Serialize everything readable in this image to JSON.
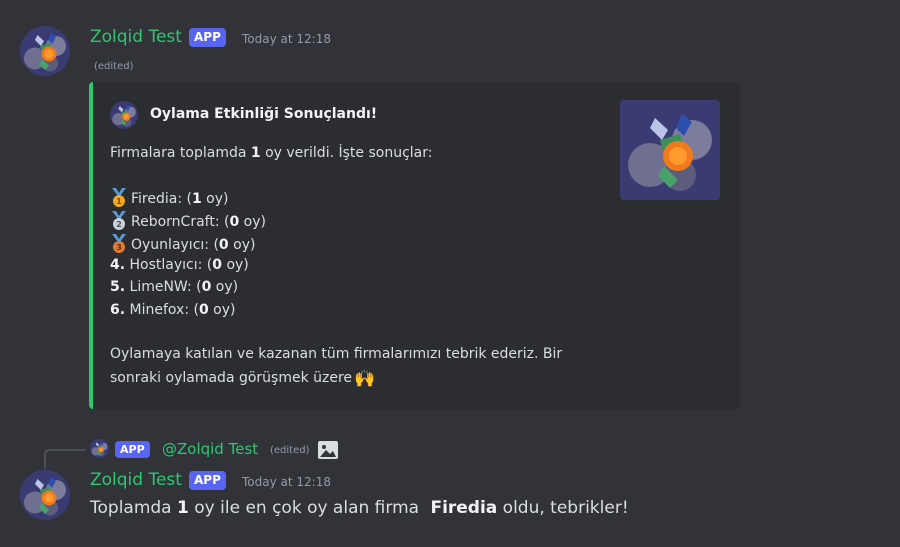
{
  "message1": {
    "username": "Zolqid Test",
    "badge": "APP",
    "timestamp": "Today at 12:18",
    "edited": "(edited)",
    "embed": {
      "accent_color": "#2dc770",
      "title": "Oylama Etkinliği Sonuçlandı!",
      "intro": {
        "before": "Firmalara toplamda ",
        "count": "1",
        "after": " oy verildi. İşte sonuçlar:"
      },
      "results": [
        {
          "rank_icon": "gold-medal-icon",
          "name": "Firedia: (",
          "votes": "1",
          "suffix": " oy)"
        },
        {
          "rank_icon": "silver-medal-icon",
          "name": "RebornCraft: (",
          "votes": "0",
          "suffix": " oy)"
        },
        {
          "rank_icon": "bronze-medal-icon",
          "name": "Oyunlayıcı: (",
          "votes": "0",
          "suffix": " oy)"
        },
        {
          "rank": "4.",
          "name": " Hostlayıcı: (",
          "votes": "0",
          "suffix": " oy)"
        },
        {
          "rank": "5.",
          "name": " LimeNW: (",
          "votes": "0",
          "suffix": " oy)"
        },
        {
          "rank": "6.",
          "name": " Minefox: (",
          "votes": "0",
          "suffix": " oy)"
        }
      ],
      "footer_line1": "Oylamaya katılan ve kazanan tüm firmalarımızı tebrik ederiz. Bir",
      "footer_line2": "sonraki oylamada görüşmek üzere",
      "footer_emoji": "🙌"
    }
  },
  "reply": {
    "badge": "APP",
    "mention": "@Zolqid Test",
    "edited": "(edited)"
  },
  "message2": {
    "username": "Zolqid Test",
    "badge": "APP",
    "timestamp": "Today at 12:18",
    "text_before": "Toplamda ",
    "count": "1",
    "text_middle": " oy ile en çok oy alan firma ",
    "winner": "Firedia",
    "text_after": " oldu, tebrikler!"
  }
}
